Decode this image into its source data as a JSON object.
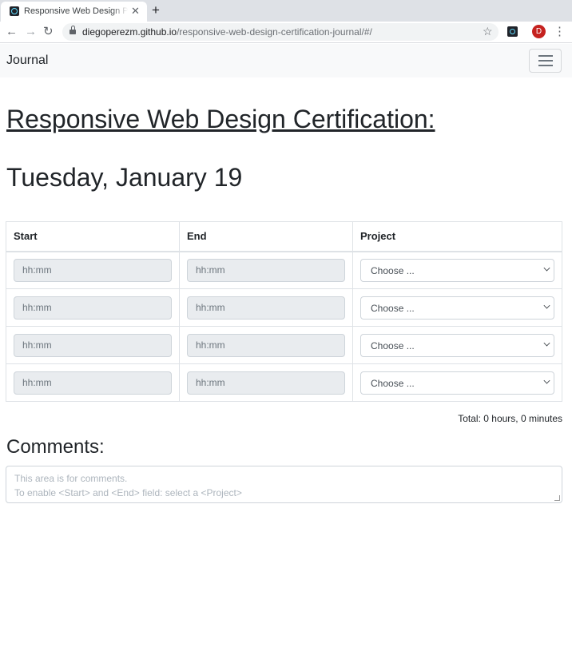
{
  "browser": {
    "tab_title": "Responsive Web Design Pr",
    "tab_close": "✕",
    "new_tab": "+",
    "back": "←",
    "forward": "→",
    "reload": "↻",
    "url_host": "diegoperezm.github.io",
    "url_path": "/responsive-web-design-certification-journal/#/",
    "star": "☆",
    "avatar_letter": "D",
    "menu": "⋮"
  },
  "navbar": {
    "brand": "Journal"
  },
  "page": {
    "title": "Responsive Web Design Certification:",
    "date": "Tuesday, January 19"
  },
  "table": {
    "headers": [
      "Start",
      "End",
      "Project"
    ],
    "rows": [
      {
        "start_placeholder": "hh:mm",
        "end_placeholder": "hh:mm",
        "project": "Choose ..."
      },
      {
        "start_placeholder": "hh:mm",
        "end_placeholder": "hh:mm",
        "project": "Choose ..."
      },
      {
        "start_placeholder": "hh:mm",
        "end_placeholder": "hh:mm",
        "project": "Choose ..."
      },
      {
        "start_placeholder": "hh:mm",
        "end_placeholder": "hh:mm",
        "project": "Choose ..."
      }
    ]
  },
  "total": {
    "label": "Total: ",
    "hours": "0 hours",
    "separator": ", ",
    "minutes": "0 minutes"
  },
  "comments": {
    "title": "Comments:",
    "placeholder_line1": "This area is for comments.",
    "placeholder_line2": "To enable <Start> and <End> field: select a <Project>"
  }
}
